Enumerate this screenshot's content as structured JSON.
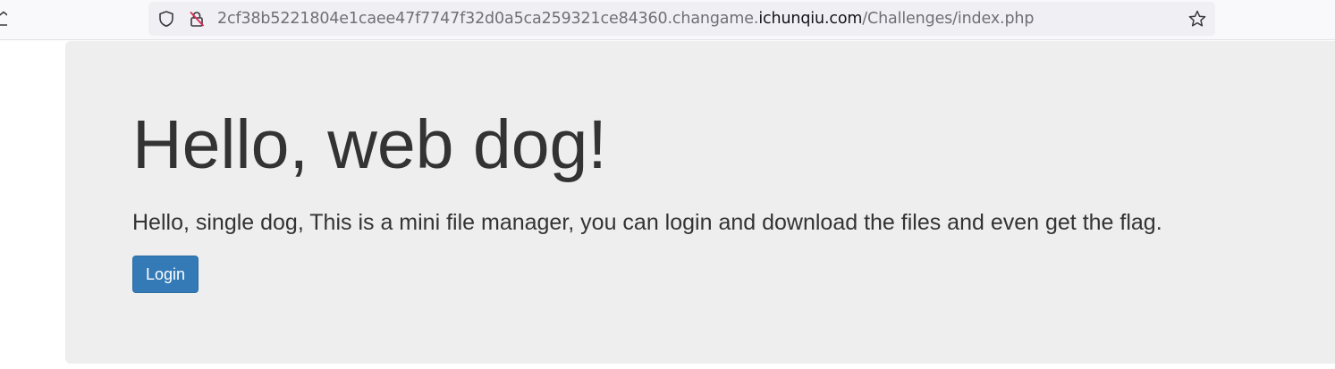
{
  "browser": {
    "url": {
      "prefix": "2cf38b5221804e1caee47f7747f32d0a5ca259321ce84360.changame.",
      "domain": "ichunqiu.com",
      "path": "/Challenges/index.php"
    },
    "icons": {
      "home": "home-icon",
      "tracking_protection": "shield-icon",
      "connection": "insecure-lock-icon",
      "bookmark": "star-icon"
    }
  },
  "page": {
    "title": "Hello, web dog!",
    "lead": "Hello, single dog, This is a mini file manager, you can login and download the files and even get the flag.",
    "login_button": "Login"
  },
  "colors": {
    "jumbotron_bg": "#eeeeee",
    "text": "#333333",
    "button_primary": "#337ab7",
    "insecure_accent": "#e22850"
  }
}
